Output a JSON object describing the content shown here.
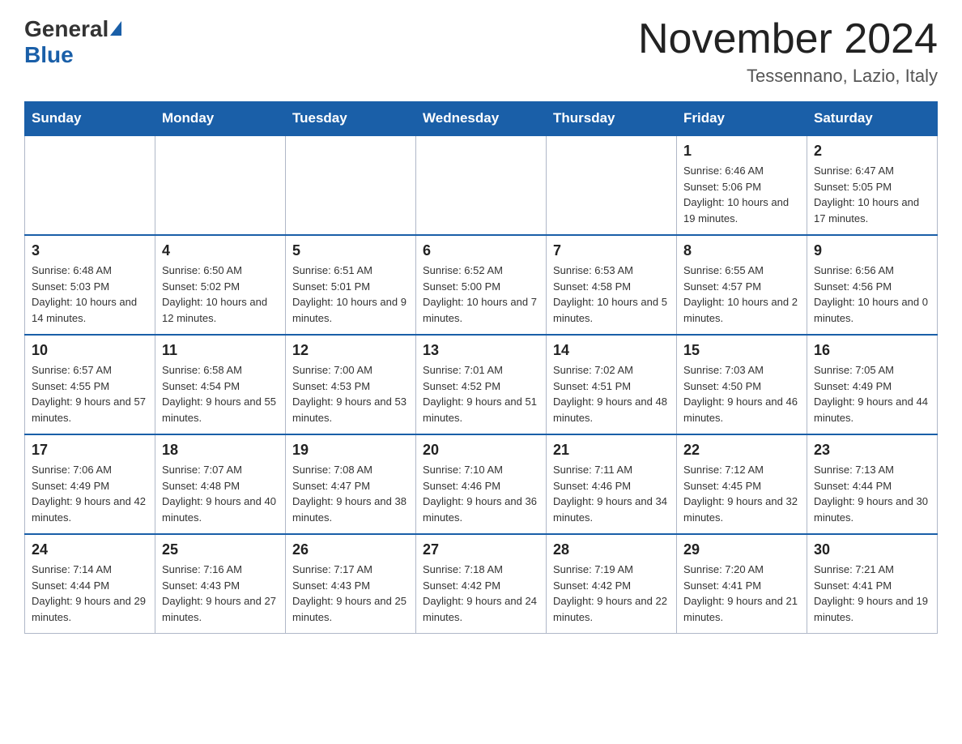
{
  "header": {
    "logo": {
      "general": "General",
      "blue": "Blue"
    },
    "month_year": "November 2024",
    "location": "Tessennano, Lazio, Italy"
  },
  "calendar": {
    "days_of_week": [
      "Sunday",
      "Monday",
      "Tuesday",
      "Wednesday",
      "Thursday",
      "Friday",
      "Saturday"
    ],
    "weeks": [
      [
        {
          "day": "",
          "info": ""
        },
        {
          "day": "",
          "info": ""
        },
        {
          "day": "",
          "info": ""
        },
        {
          "day": "",
          "info": ""
        },
        {
          "day": "",
          "info": ""
        },
        {
          "day": "1",
          "info": "Sunrise: 6:46 AM\nSunset: 5:06 PM\nDaylight: 10 hours and 19 minutes."
        },
        {
          "day": "2",
          "info": "Sunrise: 6:47 AM\nSunset: 5:05 PM\nDaylight: 10 hours and 17 minutes."
        }
      ],
      [
        {
          "day": "3",
          "info": "Sunrise: 6:48 AM\nSunset: 5:03 PM\nDaylight: 10 hours and 14 minutes."
        },
        {
          "day": "4",
          "info": "Sunrise: 6:50 AM\nSunset: 5:02 PM\nDaylight: 10 hours and 12 minutes."
        },
        {
          "day": "5",
          "info": "Sunrise: 6:51 AM\nSunset: 5:01 PM\nDaylight: 10 hours and 9 minutes."
        },
        {
          "day": "6",
          "info": "Sunrise: 6:52 AM\nSunset: 5:00 PM\nDaylight: 10 hours and 7 minutes."
        },
        {
          "day": "7",
          "info": "Sunrise: 6:53 AM\nSunset: 4:58 PM\nDaylight: 10 hours and 5 minutes."
        },
        {
          "day": "8",
          "info": "Sunrise: 6:55 AM\nSunset: 4:57 PM\nDaylight: 10 hours and 2 minutes."
        },
        {
          "day": "9",
          "info": "Sunrise: 6:56 AM\nSunset: 4:56 PM\nDaylight: 10 hours and 0 minutes."
        }
      ],
      [
        {
          "day": "10",
          "info": "Sunrise: 6:57 AM\nSunset: 4:55 PM\nDaylight: 9 hours and 57 minutes."
        },
        {
          "day": "11",
          "info": "Sunrise: 6:58 AM\nSunset: 4:54 PM\nDaylight: 9 hours and 55 minutes."
        },
        {
          "day": "12",
          "info": "Sunrise: 7:00 AM\nSunset: 4:53 PM\nDaylight: 9 hours and 53 minutes."
        },
        {
          "day": "13",
          "info": "Sunrise: 7:01 AM\nSunset: 4:52 PM\nDaylight: 9 hours and 51 minutes."
        },
        {
          "day": "14",
          "info": "Sunrise: 7:02 AM\nSunset: 4:51 PM\nDaylight: 9 hours and 48 minutes."
        },
        {
          "day": "15",
          "info": "Sunrise: 7:03 AM\nSunset: 4:50 PM\nDaylight: 9 hours and 46 minutes."
        },
        {
          "day": "16",
          "info": "Sunrise: 7:05 AM\nSunset: 4:49 PM\nDaylight: 9 hours and 44 minutes."
        }
      ],
      [
        {
          "day": "17",
          "info": "Sunrise: 7:06 AM\nSunset: 4:49 PM\nDaylight: 9 hours and 42 minutes."
        },
        {
          "day": "18",
          "info": "Sunrise: 7:07 AM\nSunset: 4:48 PM\nDaylight: 9 hours and 40 minutes."
        },
        {
          "day": "19",
          "info": "Sunrise: 7:08 AM\nSunset: 4:47 PM\nDaylight: 9 hours and 38 minutes."
        },
        {
          "day": "20",
          "info": "Sunrise: 7:10 AM\nSunset: 4:46 PM\nDaylight: 9 hours and 36 minutes."
        },
        {
          "day": "21",
          "info": "Sunrise: 7:11 AM\nSunset: 4:46 PM\nDaylight: 9 hours and 34 minutes."
        },
        {
          "day": "22",
          "info": "Sunrise: 7:12 AM\nSunset: 4:45 PM\nDaylight: 9 hours and 32 minutes."
        },
        {
          "day": "23",
          "info": "Sunrise: 7:13 AM\nSunset: 4:44 PM\nDaylight: 9 hours and 30 minutes."
        }
      ],
      [
        {
          "day": "24",
          "info": "Sunrise: 7:14 AM\nSunset: 4:44 PM\nDaylight: 9 hours and 29 minutes."
        },
        {
          "day": "25",
          "info": "Sunrise: 7:16 AM\nSunset: 4:43 PM\nDaylight: 9 hours and 27 minutes."
        },
        {
          "day": "26",
          "info": "Sunrise: 7:17 AM\nSunset: 4:43 PM\nDaylight: 9 hours and 25 minutes."
        },
        {
          "day": "27",
          "info": "Sunrise: 7:18 AM\nSunset: 4:42 PM\nDaylight: 9 hours and 24 minutes."
        },
        {
          "day": "28",
          "info": "Sunrise: 7:19 AM\nSunset: 4:42 PM\nDaylight: 9 hours and 22 minutes."
        },
        {
          "day": "29",
          "info": "Sunrise: 7:20 AM\nSunset: 4:41 PM\nDaylight: 9 hours and 21 minutes."
        },
        {
          "day": "30",
          "info": "Sunrise: 7:21 AM\nSunset: 4:41 PM\nDaylight: 9 hours and 19 minutes."
        }
      ]
    ]
  }
}
